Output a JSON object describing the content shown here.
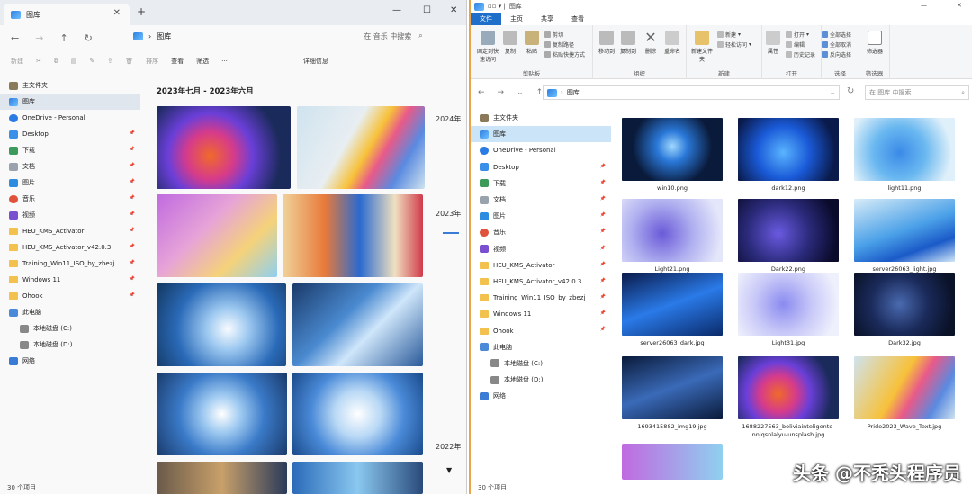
{
  "left": {
    "tab_title": "图库",
    "address": "图库",
    "search_placeholder": "在 音乐 中搜索",
    "cmd": {
      "new": "新建",
      "sort": "排序",
      "view": "查看",
      "filter": "筛选",
      "details": "详细信息"
    },
    "gallery_heading": "2023年七月 - 2023年六月",
    "years": [
      "2024年",
      "2023年",
      "2022年"
    ],
    "sidebar": [
      {
        "label": "主文件夹",
        "icon": "home-icon"
      },
      {
        "label": "图库",
        "icon": "gallery-icon",
        "selected": true
      },
      {
        "label": "OneDrive - Personal",
        "icon": "cloud-icon"
      },
      {
        "label": "Desktop",
        "icon": "desktop-icon",
        "pinned": true
      },
      {
        "label": "下载",
        "icon": "download-icon",
        "pinned": true
      },
      {
        "label": "文档",
        "icon": "document-icon",
        "pinned": true
      },
      {
        "label": "图片",
        "icon": "picture-icon",
        "pinned": true
      },
      {
        "label": "音乐",
        "icon": "music-icon",
        "pinned": true
      },
      {
        "label": "视频",
        "icon": "video-icon",
        "pinned": true
      },
      {
        "label": "HEU_KMS_Activator",
        "icon": "folder-icon",
        "pinned": true
      },
      {
        "label": "HEU_KMS_Activator_v42.0.3",
        "icon": "folder-icon",
        "pinned": true
      },
      {
        "label": "Training_Win11_ISO_by_zbezj",
        "icon": "folder-icon",
        "pinned": true
      },
      {
        "label": "Windows 11",
        "icon": "folder-icon",
        "pinned": true
      },
      {
        "label": "Ohook",
        "icon": "folder-icon",
        "pinned": true
      },
      {
        "label": "此电脑",
        "icon": "pc-icon"
      },
      {
        "label": "本地磁盘 (C:)",
        "icon": "drive-icon"
      },
      {
        "label": "本地磁盘 (D:)",
        "icon": "drive-icon"
      },
      {
        "label": "网络",
        "icon": "network-icon"
      }
    ],
    "status": "30 个项目"
  },
  "right": {
    "title": "图库",
    "ribbon_tabs": [
      "文件",
      "主页",
      "共享",
      "查看"
    ],
    "ribbon": {
      "pin": "固定到快速访问",
      "copy": "复制",
      "paste": "粘贴",
      "cut": "剪切",
      "copy_path": "复制路径",
      "paste_shortcut": "粘贴快捷方式",
      "clipboard": "剪贴板",
      "move_to": "移动到",
      "copy_to": "复制到",
      "delete": "删除",
      "rename": "重命名",
      "organize": "组织",
      "new_folder": "新建文件夹",
      "new_item": "新建",
      "easy_access": "轻松访问",
      "new_group": "新建",
      "properties": "属性",
      "open": "打开",
      "edit": "编辑",
      "history": "历史记录",
      "open_group": "打开",
      "select_all": "全部选择",
      "select_none": "全部取消",
      "invert": "反向选择",
      "select_group": "选择",
      "filter": "筛选器",
      "filter_group": "筛选器"
    },
    "address": "图库",
    "search_placeholder": "在 图库 中搜索",
    "sidebar": [
      {
        "label": "主文件夹",
        "icon": "home-icon"
      },
      {
        "label": "图库",
        "icon": "gallery-icon",
        "selected": true
      },
      {
        "label": "OneDrive - Personal",
        "icon": "cloud-icon"
      },
      {
        "label": "Desktop",
        "icon": "desktop-icon",
        "pinned": true
      },
      {
        "label": "下载",
        "icon": "download-icon",
        "pinned": true
      },
      {
        "label": "文档",
        "icon": "document-icon",
        "pinned": true
      },
      {
        "label": "图片",
        "icon": "picture-icon",
        "pinned": true
      },
      {
        "label": "音乐",
        "icon": "music-icon",
        "pinned": true
      },
      {
        "label": "视频",
        "icon": "video-icon",
        "pinned": true
      },
      {
        "label": "HEU_KMS_Activator",
        "icon": "folder-icon",
        "pinned": true
      },
      {
        "label": "HEU_KMS_Activator_v42.0.3",
        "icon": "folder-icon",
        "pinned": true
      },
      {
        "label": "Training_Win11_ISO_by_zbezj",
        "icon": "folder-icon",
        "pinned": true
      },
      {
        "label": "Windows 11",
        "icon": "folder-icon",
        "pinned": true
      },
      {
        "label": "Ohook",
        "icon": "folder-icon",
        "pinned": true
      },
      {
        "label": "此电脑",
        "icon": "pc-icon"
      },
      {
        "label": "本地磁盘 (C:)",
        "icon": "drive-icon"
      },
      {
        "label": "本地磁盘 (D:)",
        "icon": "drive-icon"
      },
      {
        "label": "网络",
        "icon": "network-icon"
      }
    ],
    "files": [
      "win10.png",
      "dark12.png",
      "light11.png",
      "Light21.png",
      "Dark22.png",
      "server26063_light.jpg",
      "server26063_dark.jpg",
      "Light31.jpg",
      "Dark32.jpg",
      "1693415882_img19.jpg",
      "1688227563_boliviainteligente-nnjqsnlalyu-unsplash.jpg",
      "Pride2023_Wave_Text.jpg"
    ],
    "status": "30 个项目"
  },
  "watermark": "头条 @不秃头程序员"
}
